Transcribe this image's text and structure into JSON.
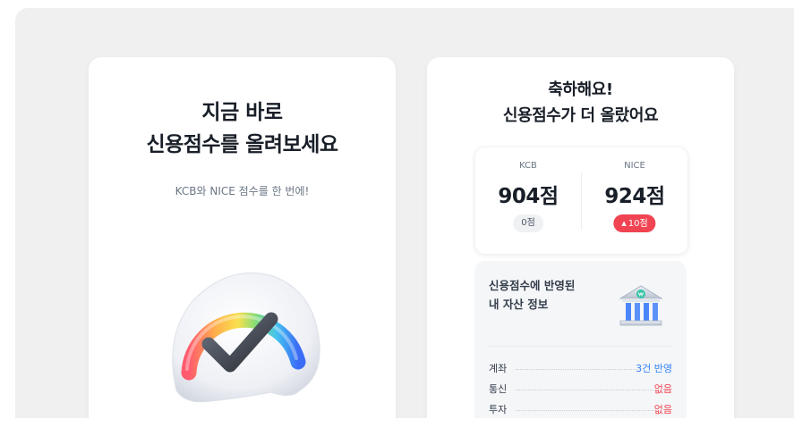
{
  "left_card": {
    "title_line1": "지금 바로",
    "title_line2": "신용점수를 올려보세요",
    "subtitle": "KCB와 NICE 점수를 한 번에!",
    "illustration": "credit-gauge-check-icon"
  },
  "right_card": {
    "title_line1": "축하해요!",
    "title_line2": "신용점수가 더 올랐어요",
    "scores": [
      {
        "bureau": "KCB",
        "score": "904점",
        "change": "0점",
        "change_style": "neutral"
      },
      {
        "bureau": "NICE",
        "score": "924점",
        "change_arrow": "▲",
        "change": "10점",
        "change_style": "up"
      }
    ],
    "assets": {
      "title_line1": "신용점수에 반영된",
      "title_line2": "내 자산 정보",
      "icon": "bank-building-icon",
      "rows": [
        {
          "label": "계좌",
          "value": "3건 반영",
          "color": "#3182f6"
        },
        {
          "label": "통신",
          "value": "없음",
          "color": "#f04452"
        },
        {
          "label": "투자",
          "value": "없음",
          "color": "#f04452"
        }
      ]
    }
  },
  "colors": {
    "background": "#f0f0f1",
    "accent_blue": "#3182f6",
    "accent_red": "#f04452",
    "text_primary": "#191f28"
  }
}
